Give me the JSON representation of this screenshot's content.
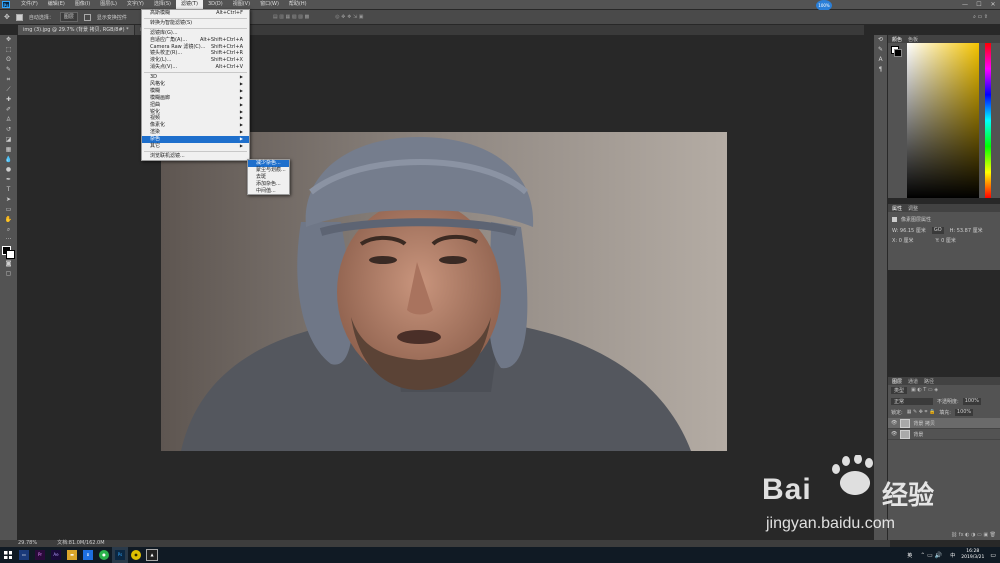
{
  "menubar": {
    "logo": "Ps",
    "items": [
      "文件(F)",
      "编辑(E)",
      "图像(I)",
      "图层(L)",
      "文字(Y)",
      "选择(S)",
      "滤镜(T)",
      "3D(D)",
      "视图(V)",
      "窗口(W)",
      "帮助(H)"
    ],
    "active_index": 6,
    "cloud_label": "100%"
  },
  "options": {
    "auto_select_label": "自动选择：",
    "layer_select": "图层",
    "transform_label": "显示变换控件"
  },
  "tabs": [
    "img (3).jpg @ 29.7% (背景 拷贝, RGB/8#) *",
    "img..."
  ],
  "filter_menu": {
    "items": [
      {
        "label": "高斯模糊",
        "shortcut": "Alt+Ctrl+F"
      },
      {
        "sep": true
      },
      {
        "label": "转换为智能滤镜(S)",
        "shortcut": ""
      },
      {
        "sep": true
      },
      {
        "label": "滤镜库(G)...",
        "shortcut": ""
      },
      {
        "label": "自适应广角(A)...",
        "shortcut": "Alt+Shift+Ctrl+A"
      },
      {
        "label": "Camera Raw 滤镜(C)...",
        "shortcut": "Shift+Ctrl+A"
      },
      {
        "label": "镜头校正(R)...",
        "shortcut": "Shift+Ctrl+R"
      },
      {
        "label": "液化(L)...",
        "shortcut": "Shift+Ctrl+X"
      },
      {
        "label": "消失点(V)...",
        "shortcut": "Alt+Ctrl+V"
      },
      {
        "sep": true
      },
      {
        "label": "3D",
        "shortcut": "",
        "sub": true
      },
      {
        "label": "风格化",
        "shortcut": "",
        "sub": true
      },
      {
        "label": "模糊",
        "shortcut": "",
        "sub": true
      },
      {
        "label": "模糊画廊",
        "shortcut": "",
        "sub": true
      },
      {
        "label": "扭曲",
        "shortcut": "",
        "sub": true
      },
      {
        "label": "锐化",
        "shortcut": "",
        "sub": true
      },
      {
        "label": "视频",
        "shortcut": "",
        "sub": true
      },
      {
        "label": "像素化",
        "shortcut": "",
        "sub": true
      },
      {
        "label": "渲染",
        "shortcut": "",
        "sub": true
      },
      {
        "label": "杂色",
        "shortcut": "",
        "sub": true,
        "hl": true
      },
      {
        "label": "其它",
        "shortcut": "",
        "sub": true
      },
      {
        "sep": true
      },
      {
        "label": "浏览联机滤镜...",
        "shortcut": ""
      }
    ]
  },
  "noise_submenu": [
    "减少杂色...",
    "蒙尘与划痕...",
    "去斑",
    "添加杂色...",
    "中间值..."
  ],
  "color_panel": {
    "tabs": [
      "颜色",
      "色板"
    ]
  },
  "props_panel": {
    "tabs": [
      "属性",
      "调整"
    ],
    "title": "像素图层属性",
    "w": "W: 96.15 厘米",
    "h": "H: 53.87 厘米",
    "x": "X: 0 厘米",
    "y": "Y: 0 厘米",
    "link": "GO"
  },
  "layers_panel": {
    "tabs": [
      "图层",
      "通道",
      "路径"
    ],
    "kind": "类型",
    "mode": "正常",
    "opacity_label": "不透明度:",
    "opacity": "100%",
    "lock_label": "锁定:",
    "fill_label": "填充:",
    "fill": "100%",
    "layers": [
      {
        "name": "背景 拷贝",
        "selected": true
      },
      {
        "name": "背景",
        "selected": false
      }
    ]
  },
  "status": {
    "zoom": "29.78%",
    "doc": "文档:81.0M/162.0M"
  },
  "taskbar": {
    "time": "16:28",
    "date": "2019/3/21",
    "ime": "英",
    "lang": "中"
  },
  "watermark": {
    "brand": "Bai",
    "brand2": "经验",
    "url": "jingyan.baidu.com"
  }
}
